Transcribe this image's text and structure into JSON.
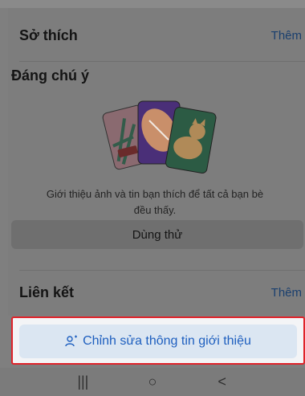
{
  "hobbies": {
    "title": "Sở thích",
    "action": "Thêm"
  },
  "notable": {
    "title": "Đáng chú ý",
    "description_line1": "Giới thiệu ảnh và tin bạn thích để tất cả bạn bè",
    "description_line2": "đều thấy.",
    "try_button": "Dùng thử"
  },
  "links": {
    "title": "Liên kết",
    "action": "Thêm"
  },
  "edit_button": {
    "label": "Chỉnh sửa thông tin giới thiệu",
    "icon": "person-edit-icon",
    "highlight_color": "#e0232a",
    "text_color": "#1e5fbf"
  },
  "system_nav": {
    "recents": "|||",
    "home": "○",
    "back": "<"
  }
}
